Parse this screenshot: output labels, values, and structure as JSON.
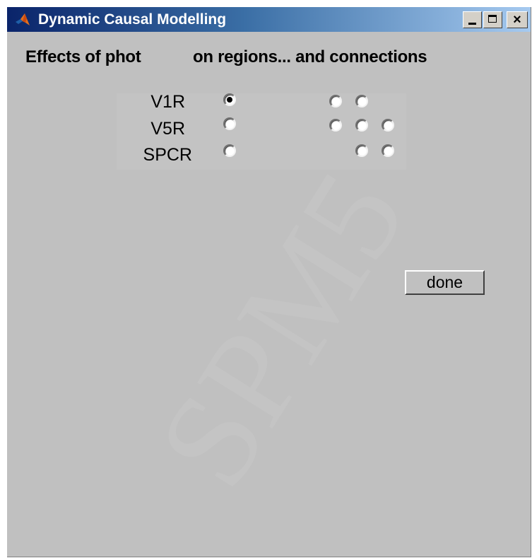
{
  "window": {
    "title": "Dynamic Causal Modelling",
    "title_bar_color": "#0a246a",
    "background_color": "#c0c0c0",
    "controls": {
      "minimize_glyph": "",
      "maximize_glyph": "",
      "close_glyph": "×"
    }
  },
  "heading": {
    "left": "Effects of phot",
    "right": "on regions... and connections"
  },
  "regions": [
    {
      "label": "V1R",
      "selected": true
    },
    {
      "label": "V5R",
      "selected": false
    },
    {
      "label": "SPCR",
      "selected": false
    }
  ],
  "connections": {
    "rows": [
      [
        true,
        true,
        false
      ],
      [
        true,
        true,
        true
      ],
      [
        false,
        true,
        true
      ]
    ],
    "selected": []
  },
  "done_button": {
    "label": "done"
  },
  "watermark": {
    "text": "SPM5"
  },
  "icons": [
    "matlab-logo-icon",
    "minimize-icon",
    "maximize-icon",
    "close-icon"
  ]
}
